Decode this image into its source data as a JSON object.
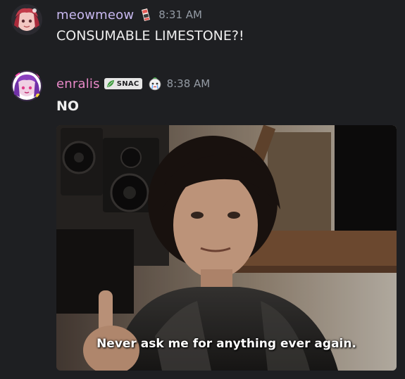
{
  "messages": [
    {
      "username": "meowmeow",
      "role_icon": "sushi-roll-icon",
      "timestamp": "8:31 AM",
      "text": "CONSUMABLE LIMESTONE?!",
      "name_color": "#c8b8f0"
    },
    {
      "username": "enralis",
      "tag": {
        "icon": "leaf-icon",
        "label": "SNAC"
      },
      "role_icon": "crying-emoji-icon",
      "timestamp": "8:38 AM",
      "text": "NO",
      "name_color": "#e889c8",
      "image": {
        "caption": "Never ask me for anything ever again."
      }
    }
  ],
  "colors": {
    "background": "#1e1f22",
    "timestamp": "#949ba4",
    "text": "#eeeeee"
  }
}
